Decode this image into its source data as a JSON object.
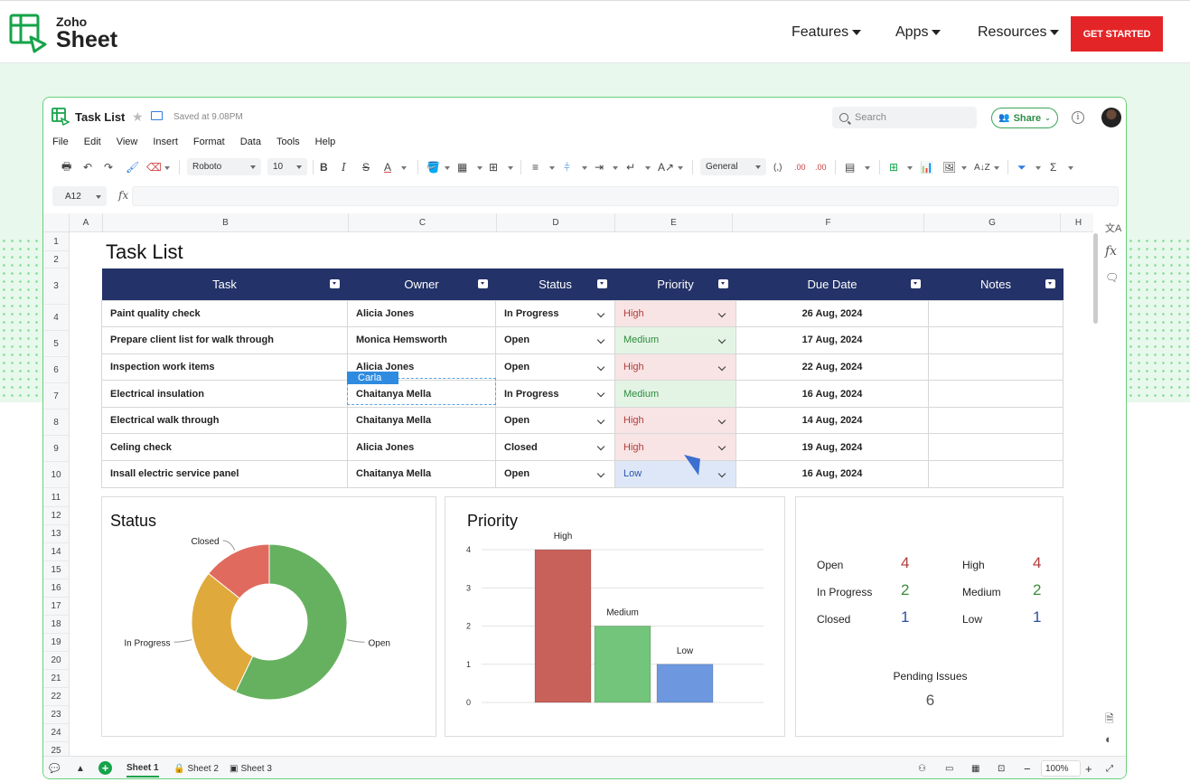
{
  "site": {
    "logo_top": "Zoho",
    "logo_bottom": "Sheet",
    "nav": [
      "Features",
      "Apps",
      "Resources"
    ],
    "cta": "GET STARTED"
  },
  "app": {
    "doc_title": "Task List",
    "saved": "Saved at 9.08PM",
    "search_placeholder": "Search",
    "share": "Share",
    "info": "i",
    "menu": [
      "File",
      "Edit",
      "View",
      "Insert",
      "Format",
      "Data",
      "Tools",
      "Help"
    ],
    "toolbar": {
      "font": "Roboto",
      "size": "10",
      "bold": "B",
      "italic": "I",
      "strike": "S",
      "font_color": "A",
      "number_format": "General",
      "thousands": "(,)",
      "dec_decrease": ".00",
      "dec_increase": ".00",
      "sum": "Σ"
    },
    "cell_ref": "A12",
    "fx": "fx"
  },
  "grid": {
    "columns": [
      "A",
      "B",
      "C",
      "D",
      "E",
      "F",
      "G",
      "H"
    ],
    "rows": [
      "1",
      "2",
      "3",
      "4",
      "5",
      "6",
      "7",
      "8",
      "9",
      "10",
      "11",
      "12",
      "13",
      "14",
      "15",
      "16",
      "17",
      "18",
      "19",
      "20",
      "21",
      "22",
      "23",
      "24",
      "25"
    ],
    "sheet_title": "Task List",
    "headers": [
      "Task",
      "Owner",
      "Status",
      "Priority",
      "Due Date",
      "Notes"
    ],
    "tasks": [
      {
        "task": "Paint quality check",
        "owner": "Alicia Jones",
        "status": "In Progress",
        "priority": "High",
        "due": "26 Aug, 2024"
      },
      {
        "task": "Prepare client list for walk through",
        "owner": "Monica Hemsworth",
        "status": "Open",
        "priority": "Medium",
        "due": "17 Aug, 2024"
      },
      {
        "task": "Inspection work items",
        "owner": "Alicia Jones",
        "status": "Open",
        "priority": "High",
        "due": "22 Aug, 2024"
      },
      {
        "task": "Electrical insulation",
        "owner": "Chaitanya Mella",
        "status": "In Progress",
        "priority": "Medium",
        "due": "16 Aug, 2024"
      },
      {
        "task": "Electrical walk through",
        "owner": "Chaitanya Mella",
        "status": "Open",
        "priority": "High",
        "due": "14 Aug, 2024"
      },
      {
        "task": "Celing check",
        "owner": "Alicia Jones",
        "status": "Closed",
        "priority": "High",
        "due": "19 Aug, 2024"
      },
      {
        "task": "Insall electric service panel",
        "owner": "Chaitanya Mella",
        "status": "Open",
        "priority": "Low",
        "due": "16 Aug, 2024"
      }
    ],
    "collaborator": "Carla"
  },
  "chart_data": [
    {
      "type": "pie",
      "title": "Status",
      "categories": [
        "Open",
        "In Progress",
        "Closed"
      ],
      "values": [
        4,
        2,
        1
      ],
      "colors": [
        "#66b15f",
        "#dfaa3b",
        "#e06a5e"
      ],
      "donut": true
    },
    {
      "type": "bar",
      "title": "Priority",
      "categories": [
        "High",
        "Medium",
        "Low"
      ],
      "values": [
        4,
        2,
        1
      ],
      "colors": [
        "#c9615b",
        "#72c57a",
        "#6d98e0"
      ],
      "ylim": [
        0,
        4
      ],
      "yticks": [
        "0",
        "1",
        "2",
        "3",
        "4"
      ],
      "grid": true
    }
  ],
  "summary": {
    "status": [
      {
        "label": "Open",
        "value": "4"
      },
      {
        "label": "In Progress",
        "value": "2"
      },
      {
        "label": "Closed",
        "value": "1"
      }
    ],
    "priority": [
      {
        "label": "High",
        "value": "4"
      },
      {
        "label": "Medium",
        "value": "2"
      },
      {
        "label": "Low",
        "value": "1"
      }
    ],
    "pending_label": "Pending Issues",
    "pending_value": "6"
  },
  "bottom": {
    "sheets": [
      "Sheet 1",
      "Sheet 2",
      "Sheet 3"
    ],
    "zoom": "100%",
    "minus": "−",
    "plus": "+"
  },
  "colors": {
    "brand_red": "#e42527",
    "header_navy": "#233268",
    "accent_green": "#3aa55a"
  }
}
